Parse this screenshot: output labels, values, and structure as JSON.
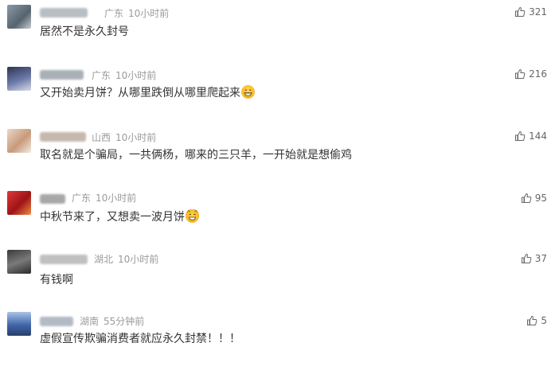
{
  "comments": [
    {
      "location": "广东",
      "time": "10小时前",
      "text": "居然不是永久封号",
      "likes": "321",
      "avatar_color": "#6b7b88",
      "emoji": ""
    },
    {
      "location": "广东",
      "time": "10小时前",
      "text": "又开始卖月饼？从哪里跌倒从哪里爬起来",
      "likes": "216",
      "avatar_color": "#3c4560",
      "emoji": "grinning-sweat-emoji"
    },
    {
      "location": "山西",
      "time": "10小时前",
      "text": "取名就是个骗局，一共俩杨，哪来的三只羊，一开始就是想偷鸡",
      "likes": "144",
      "avatar_color": "#c9a68a",
      "emoji": ""
    },
    {
      "location": "广东",
      "time": "10小时前",
      "text": "中秋节来了，又想卖一波月饼",
      "likes": "95",
      "avatar_color": "#c0282a",
      "emoji": "grinning-cat-emoji"
    },
    {
      "location": "湖北",
      "time": "10小时前",
      "text": "有钱啊",
      "likes": "37",
      "avatar_color": "#5b5b5b",
      "emoji": ""
    },
    {
      "location": "湖南",
      "time": "55分钟前",
      "text": "虚假宣传欺骗消费者就应永久封禁！！！",
      "likes": "5",
      "avatar_color": "#5a7bb5",
      "emoji": ""
    }
  ],
  "colors": {
    "text": "#333333",
    "meta": "#9a9a9a",
    "like": "#666666"
  }
}
